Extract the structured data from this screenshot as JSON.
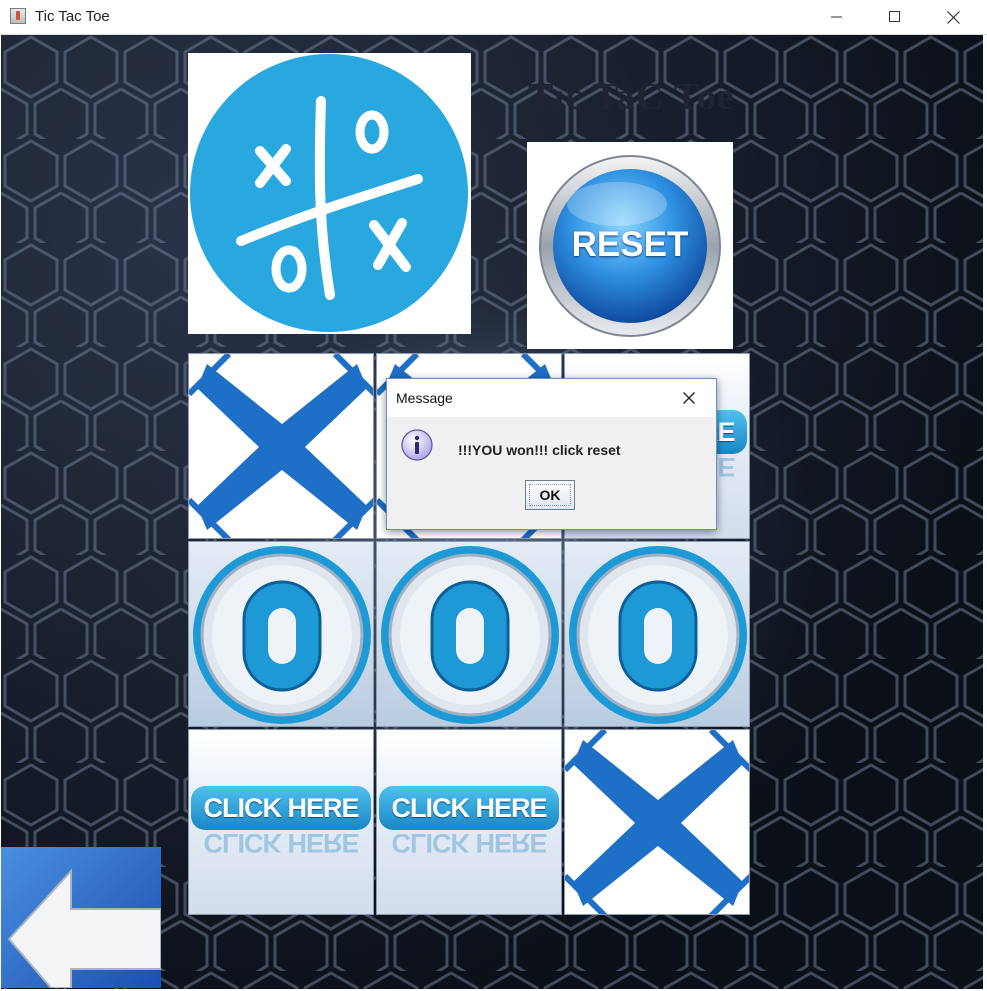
{
  "window": {
    "title": "Tic Tac Toe",
    "controls": [
      "minimize-icon",
      "maximize-icon",
      "close-icon"
    ]
  },
  "game": {
    "heading": "Tic TaC Toe",
    "reset_label": "RESET",
    "logo_icon": "tic-tac-toe-logo-icon",
    "back_icon": "back-arrow-icon",
    "board": [
      [
        "X",
        "X",
        "CLICK HERE"
      ],
      [
        "O",
        "O",
        "O"
      ],
      [
        "CLICK HERE",
        "CLICK HERE",
        "X"
      ]
    ],
    "click_label": "CLICK HERE",
    "o_label": "O"
  },
  "dialog": {
    "title": "Message",
    "message": "!!!YOU won!!! click reset",
    "ok_label": "OK",
    "icon": "info-icon"
  },
  "colors": {
    "accent": "#29a8e0",
    "button_blue": "#1a86c4",
    "x_blue": "#1e6fc6",
    "dialog_border": "#6f8fc2"
  }
}
